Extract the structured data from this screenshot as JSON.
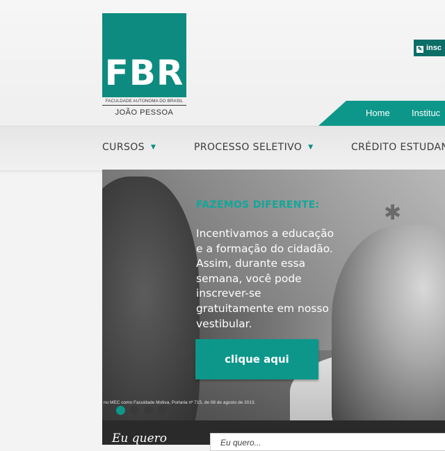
{
  "logo": {
    "letters": "FBR",
    "subtitle": "FACULDADE AUTÔNOMA DO BRASIL",
    "city": "JOÃO PESSOA"
  },
  "header": {
    "inscricao_label": "insc",
    "topnav": [
      "Home",
      "Instituc"
    ]
  },
  "menu": [
    "CURSOS",
    "PROCESSO SELETIVO",
    "CRÉDITO ESTUDAN"
  ],
  "hero": {
    "title": "FAZEMOS DIFERENTE:",
    "text": "Incentivamos a educação e a formação do cidadão. Assim, durante essa semana, você pode inscrever-se gratuitamente em nosso vestibular.",
    "cta": "clique aqui",
    "fine_print": "no MEC como Faculdade Motiva, Portaria nº 715, de 08 de agosto de 2013.",
    "slides": 4,
    "active_slide": 1
  },
  "bottom": {
    "label": "Eu quero",
    "field_value": "Eu quero..."
  },
  "colors": {
    "brand": "#0d8b80",
    "accent": "#0d978a",
    "title_accent": "#10a89a"
  }
}
